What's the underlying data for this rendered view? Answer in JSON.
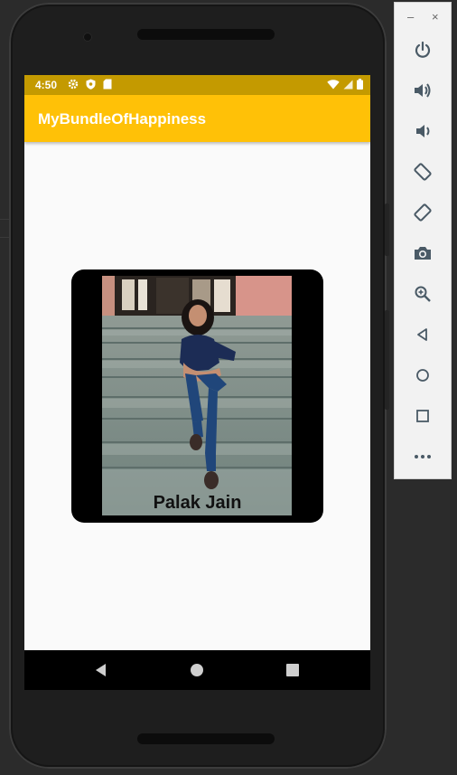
{
  "status_bar": {
    "time": "4:50",
    "left_icons": [
      "settings-icon",
      "shield-icon",
      "sd-card-icon"
    ],
    "right_icons": [
      "wifi-icon",
      "signal-icon",
      "battery-icon"
    ]
  },
  "app_bar": {
    "title": "MyBundleOfHappiness"
  },
  "card": {
    "caption": "Palak Jain"
  },
  "nav_bar": {
    "buttons": [
      "back-icon",
      "home-icon",
      "recents-icon"
    ]
  },
  "emulator_toolbar": {
    "window_controls": {
      "minimize": "–",
      "close": "×"
    },
    "tools": [
      "power-icon",
      "volume-up-icon",
      "volume-down-icon",
      "rotate-left-icon",
      "rotate-right-icon",
      "camera-icon",
      "zoom-icon",
      "back-icon",
      "home-icon",
      "overview-icon",
      "more-icon"
    ]
  },
  "colors": {
    "status_bar": "#c49a00",
    "app_bar": "#ffc107",
    "screen_bg": "#fafafa",
    "card_bg": "#000000",
    "toolbar_icon": "#4a5a66"
  }
}
